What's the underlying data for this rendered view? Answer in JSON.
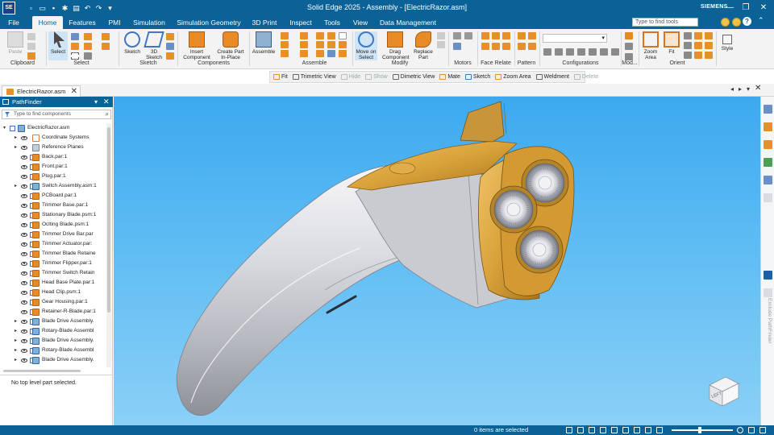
{
  "app": {
    "logo_text": "SE",
    "title": "Solid Edge 2025 - Assembly - [ElectricRazor.asm]",
    "brand": "SIEMENS",
    "window_controls": [
      "—",
      "❐",
      "✕"
    ]
  },
  "quick_access": [
    "new-icon",
    "open-icon",
    "save-icon",
    "settings-icon",
    "print-icon",
    "undo-icon",
    "redo-icon",
    "customize-icon"
  ],
  "menu": {
    "tabs": [
      "File",
      "Home",
      "Features",
      "PMI",
      "Simulation",
      "Simulation Geometry",
      "3D Print",
      "Inspect",
      "Tools",
      "View",
      "Data Management"
    ],
    "active": "Home",
    "tool_search_placeholder": "Type to find tools"
  },
  "ribbon": {
    "groups": [
      "Clipboard",
      "Select",
      "Sketch",
      "Components",
      "Assemble",
      "Modify",
      "Motors",
      "Face Relate",
      "Pattern",
      "Configurations",
      "Mod...",
      "Orient"
    ],
    "buttons": {
      "paste": "Paste",
      "select": "Select",
      "sketch": "Sketch",
      "sketch3d": "3D Sketch",
      "insert_component": "Insert Component",
      "create_part": "Create Part In-Place",
      "assemble": "Assemble",
      "move_on_select": "Move on Select",
      "drag_component": "Drag Component",
      "replace_part": "Replace Part",
      "zoom_area": "Zoom Area",
      "fit": "Fit",
      "style": "Style"
    }
  },
  "view_bar": {
    "commands": [
      {
        "label": "Fit",
        "enabled": true
      },
      {
        "label": "Trimetric View",
        "enabled": true
      },
      {
        "label": "Hide",
        "enabled": false
      },
      {
        "label": "Show",
        "enabled": false
      },
      {
        "label": "Dimetric View",
        "enabled": true
      },
      {
        "label": "Mate",
        "enabled": true
      },
      {
        "label": "Sketch",
        "enabled": true
      },
      {
        "label": "Zoom Area",
        "enabled": true
      },
      {
        "label": "Weldment",
        "enabled": true
      },
      {
        "label": "Delete",
        "enabled": false
      }
    ]
  },
  "document_tab": {
    "label": "ElectricRazor.asm",
    "close": "✕"
  },
  "pathfinder": {
    "title": "PathFinder",
    "search_placeholder": "Type to find components",
    "tree": [
      {
        "label": "ElectricRazor.asm",
        "level": 0,
        "icon": "asm",
        "expand": "▾",
        "eye": false,
        "check": true
      },
      {
        "label": "Coordinate Systems",
        "level": 1,
        "icon": "csys",
        "expand": "▸",
        "eye": true,
        "check": false
      },
      {
        "label": "Reference Planes",
        "level": 1,
        "icon": "plane",
        "expand": "▸",
        "eye": true,
        "check": false
      },
      {
        "label": "Back.par:1",
        "level": 2,
        "icon": "part",
        "expand": "",
        "eye": true,
        "check": true
      },
      {
        "label": "Front.par:1",
        "level": 2,
        "icon": "part",
        "expand": "",
        "eye": true,
        "check": true
      },
      {
        "label": "Plug.par:1",
        "level": 2,
        "icon": "part",
        "expand": "",
        "eye": true,
        "check": true
      },
      {
        "label": "Switch Assembly.asm:1",
        "level": 1,
        "icon": "asm",
        "expand": "▸",
        "eye": true,
        "check": true
      },
      {
        "label": "PCBoard.par:1",
        "level": 2,
        "icon": "part",
        "expand": "",
        "eye": true,
        "check": true
      },
      {
        "label": "Trimmer Base.par:1",
        "level": 2,
        "icon": "part",
        "expand": "",
        "eye": true,
        "check": true
      },
      {
        "label": "Stationary Blade.psm:1",
        "level": 2,
        "icon": "part",
        "expand": "",
        "eye": true,
        "check": true
      },
      {
        "label": "Oclting Blade.psm:1",
        "level": 2,
        "icon": "part",
        "expand": "",
        "eye": true,
        "check": true
      },
      {
        "label": "Trimmer Drive Bar.par",
        "level": 2,
        "icon": "part",
        "expand": "",
        "eye": true,
        "check": true
      },
      {
        "label": "Trimmer Actuator.par:",
        "level": 2,
        "icon": "part",
        "expand": "",
        "eye": true,
        "check": true
      },
      {
        "label": "Trimmer Blade Retaine",
        "level": 2,
        "icon": "part",
        "expand": "",
        "eye": true,
        "check": true
      },
      {
        "label": "Trimmer Flipper.par:1",
        "level": 2,
        "icon": "part",
        "expand": "",
        "eye": true,
        "check": true
      },
      {
        "label": "Trimmer Switch Retain",
        "level": 2,
        "icon": "part",
        "expand": "",
        "eye": true,
        "check": true
      },
      {
        "label": "Head Base Plate.par:1",
        "level": 2,
        "icon": "part",
        "expand": "",
        "eye": true,
        "check": true
      },
      {
        "label": "Head Clip.psm:1",
        "level": 2,
        "icon": "part",
        "expand": "",
        "eye": true,
        "check": true
      },
      {
        "label": "Gear Housing.par:1",
        "level": 2,
        "icon": "part",
        "expand": "",
        "eye": true,
        "check": true
      },
      {
        "label": "Retainer-R-Blade.par:1",
        "level": 2,
        "icon": "part",
        "expand": "",
        "eye": true,
        "check": true
      },
      {
        "label": "Blade Drive Assembly.",
        "level": 1,
        "icon": "asm",
        "expand": "▸",
        "eye": true,
        "check": true
      },
      {
        "label": "Rotary-Blade Assembl",
        "level": 1,
        "icon": "asm",
        "expand": "▸",
        "eye": true,
        "check": true
      },
      {
        "label": "Blade Drive Assembly.",
        "level": 1,
        "icon": "asm",
        "expand": "▸",
        "eye": true,
        "check": true
      },
      {
        "label": "Rotary-Blade Assembl",
        "level": 1,
        "icon": "asm",
        "expand": "▸",
        "eye": true,
        "check": true
      },
      {
        "label": "Blade Drive Assembly.",
        "level": 1,
        "icon": "asm",
        "expand": "▸",
        "eye": true,
        "check": true
      }
    ],
    "status": "No top level part selected."
  },
  "viewport": {
    "view_cube_label": "LEFT"
  },
  "right_rail": {
    "vertical_label": "Exclude PathFinder"
  },
  "status_bar": {
    "message": "0 items are selected"
  },
  "colors": {
    "accent": "#0b6296",
    "part": "#e88b26",
    "gold": "#d9a23a",
    "viewport_top": "#3ca9ef"
  }
}
